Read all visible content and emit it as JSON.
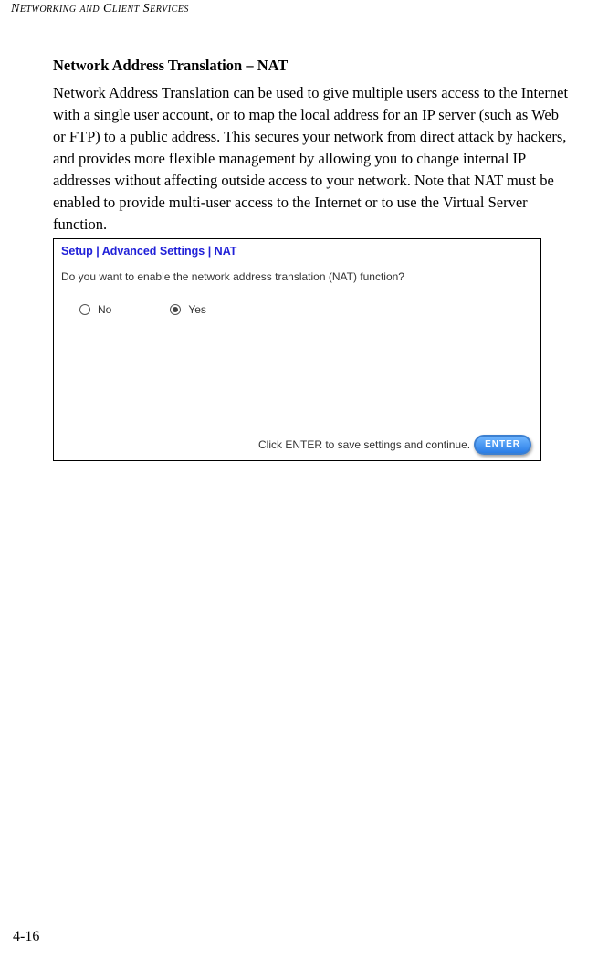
{
  "header": "Networking and Client Services",
  "section_title": "Network Address Translation – NAT",
  "body_text": "Network Address Translation can be used to give multiple users access to the Internet with a single user account, or to map the local address for an IP server (such as Web or FTP) to a public address. This secures your network from direct attack by hackers, and provides more flexible management by allowing you to change internal IP addresses without affecting outside access to your network. Note that NAT must be enabled to provide multi-user access to the Internet or to use the Virtual Server function.",
  "panel": {
    "breadcrumb": "Setup | Advanced Settings | NAT",
    "question": "Do you want to enable the network address translation (NAT) function?",
    "option_no": "No",
    "option_yes": "Yes",
    "footer_text": "Click ENTER to save settings and continue.",
    "enter_label": "ENTER"
  },
  "page_number": "4-16"
}
